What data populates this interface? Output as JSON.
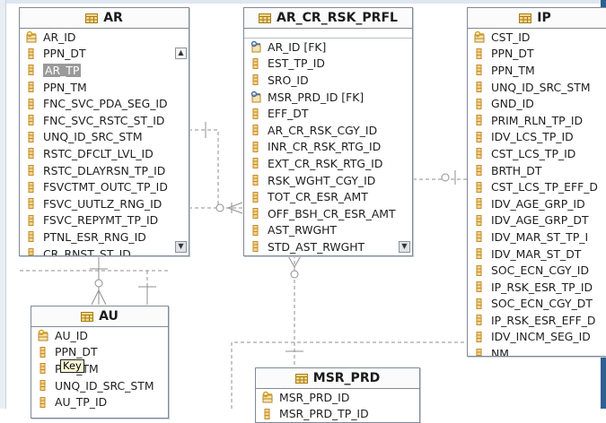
{
  "entities": {
    "ar": {
      "name": "AR",
      "columns": [
        {
          "name": "AR_ID",
          "key": "pk"
        },
        {
          "name": "PPN_DT",
          "key": "none"
        },
        {
          "name": "AR_TP",
          "key": "none",
          "selected": true
        },
        {
          "name": "PPN_TM",
          "key": "none"
        },
        {
          "name": "FNC_SVC_PDA_SEG_ID",
          "key": "none"
        },
        {
          "name": "FNC_SVC_RSTC_ST_ID",
          "key": "none"
        },
        {
          "name": "UNQ_ID_SRC_STM",
          "key": "none"
        },
        {
          "name": "RSTC_DFCLT_LVL_ID",
          "key": "none"
        },
        {
          "name": "RSTC_DLAYRSN_TP_ID",
          "key": "none"
        },
        {
          "name": "FSVCTMT_OUTC_TP_ID",
          "key": "none"
        },
        {
          "name": "FSVC_UUTLZ_RNG_ID",
          "key": "none"
        },
        {
          "name": "FSVC_REPYMT_TP_ID",
          "key": "none"
        },
        {
          "name": "PTNL_ESR_RNG_ID",
          "key": "none"
        },
        {
          "name": "CR_RNST_ST_ID",
          "key": "none"
        }
      ]
    },
    "ar_cr_rsk_prfl": {
      "name": "AR_CR_RSK_PRFL",
      "columns": [
        {
          "name": "AR_ID [FK]",
          "key": "fk"
        },
        {
          "name": "EST_TP_ID",
          "key": "none"
        },
        {
          "name": "SRO_ID",
          "key": "none"
        },
        {
          "name": "MSR_PRD_ID [FK]",
          "key": "fk"
        },
        {
          "name": "EFF_DT",
          "key": "none"
        },
        {
          "name": "AR_CR_RSK_CGY_ID",
          "key": "none"
        },
        {
          "name": "INR_CR_RSK_RTG_ID",
          "key": "none"
        },
        {
          "name": "EXT_CR_RSK_RTG_ID",
          "key": "none"
        },
        {
          "name": "RSK_WGHT_CGY_ID",
          "key": "none"
        },
        {
          "name": "TOT_CR_ESR_AMT",
          "key": "none"
        },
        {
          "name": "OFF_BSH_CR_ESR_AMT",
          "key": "none"
        },
        {
          "name": "AST_RWGHT",
          "key": "none"
        },
        {
          "name": "STD_AST_RWGHT",
          "key": "none"
        }
      ]
    },
    "ip": {
      "name": "IP",
      "columns": [
        {
          "name": "CST_ID",
          "key": "pk"
        },
        {
          "name": "PPN_DT",
          "key": "none"
        },
        {
          "name": "PPN_TM",
          "key": "none"
        },
        {
          "name": "UNQ_ID_SRC_STM",
          "key": "none"
        },
        {
          "name": "GND_ID",
          "key": "none"
        },
        {
          "name": "PRIM_RLN_TP_ID",
          "key": "none"
        },
        {
          "name": "IDV_LCS_TP_ID",
          "key": "none"
        },
        {
          "name": "CST_LCS_TP_ID",
          "key": "none"
        },
        {
          "name": "BRTH_DT",
          "key": "none"
        },
        {
          "name": "CST_LCS_TP_EFF_D",
          "key": "none"
        },
        {
          "name": "IDV_AGE_GRP_ID",
          "key": "none"
        },
        {
          "name": "IDV_AGE_GRP_DT",
          "key": "none"
        },
        {
          "name": "IDV_MAR_ST_TP_I",
          "key": "none"
        },
        {
          "name": "IDV_MAR_ST_DT",
          "key": "none"
        },
        {
          "name": "SOC_ECN_CGY_ID",
          "key": "none"
        },
        {
          "name": "IP_RSK_ESR_TP_ID",
          "key": "none"
        },
        {
          "name": "SOC_ECN_CGY_DT",
          "key": "none"
        },
        {
          "name": "IP_RSK_ESR_EFF_D",
          "key": "none"
        },
        {
          "name": "IDV_INCM_SEG_ID",
          "key": "none"
        },
        {
          "name": "NM",
          "key": "none"
        }
      ]
    },
    "au": {
      "name": "AU",
      "columns": [
        {
          "name": "AU_ID",
          "key": "pk"
        },
        {
          "name": "PPN_DT",
          "key": "none"
        },
        {
          "name": "PPN_TM",
          "key": "none"
        },
        {
          "name": "UNQ_ID_SRC_STM",
          "key": "none"
        },
        {
          "name": "AU_TP_ID",
          "key": "none"
        }
      ]
    },
    "msr_prd": {
      "name": "MSR_PRD",
      "columns": [
        {
          "name": "MSR_PRD_ID",
          "key": "pk"
        },
        {
          "name": "MSR_PRD_TP_ID",
          "key": "none"
        }
      ]
    }
  },
  "tooltip": {
    "text": "Key"
  },
  "icons": {
    "pk": "key-column-icon",
    "fk": "foreign-key-column-icon",
    "none": "column-icon",
    "table": "table-icon"
  },
  "colors": {
    "pk_key": "#d4a017",
    "column_icon": "#c58a2a",
    "fk_icon": "#3b6fb6",
    "selection": "#9a9a9a",
    "connector": "#8f8f8f",
    "tooltip_bg": "#fffbd8"
  }
}
